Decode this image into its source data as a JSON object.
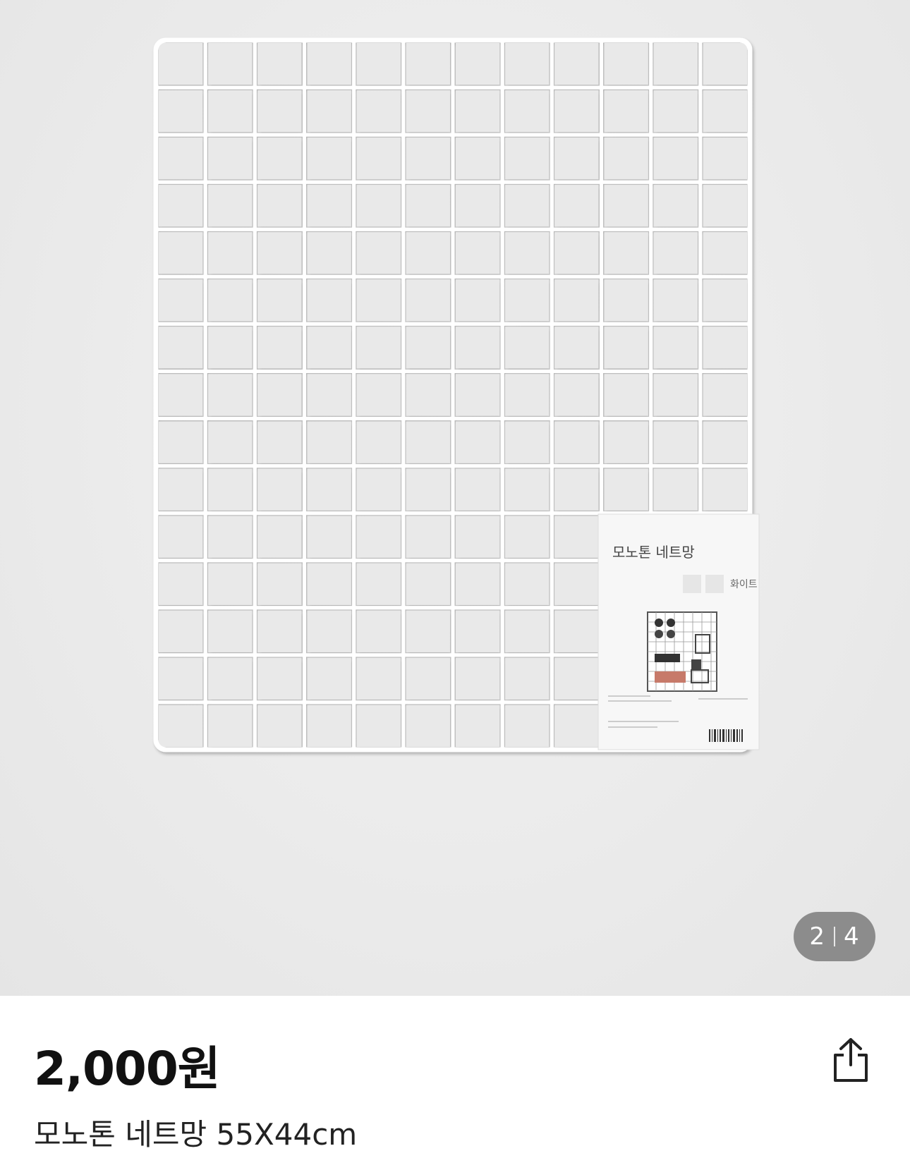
{
  "gallery": {
    "image_alt": "모노톤 네트망 product photo",
    "package_label_title": "모노톤 네트망",
    "package_label_color": "화이트",
    "current_page": "2",
    "total_pages": "4"
  },
  "product": {
    "price": "2,000원",
    "title": "모노톤 네트망 55X44cm"
  },
  "actions": {
    "share_icon": "share-icon"
  }
}
